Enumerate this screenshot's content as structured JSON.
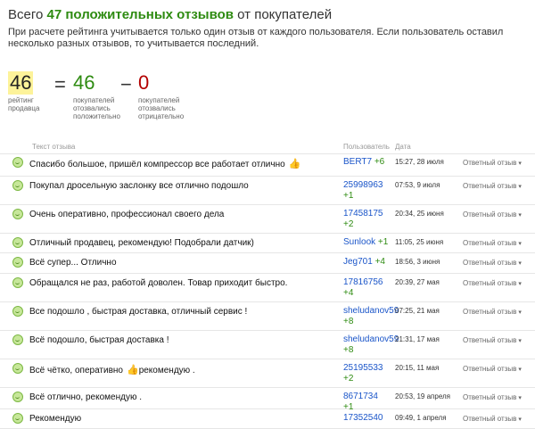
{
  "header": {
    "prefix": "Всего",
    "highlight": "47 положительных отзывов",
    "suffix": "от покупателей"
  },
  "notice": "При расчете рейтинга учитывается только один отзыв от каждого пользователя. Если пользователь оставил несколько разных отзывов, то учитывается последний.",
  "stats": {
    "rating": {
      "value": "46",
      "caption": "рейтинг продавца"
    },
    "equals": "=",
    "positive": {
      "value": "46",
      "caption": "покупателей отозвались положительно"
    },
    "minus": "−",
    "negative": {
      "value": "0",
      "caption": "покупателей отозвались отрицательно"
    }
  },
  "table": {
    "col_text": "Текст отзыва",
    "col_user": "Пользователь",
    "col_date": "Дата",
    "reply_label": "Ответный отзыв",
    "rows": [
      {
        "text": "Спасибо большое, пришёл компрессор все работает отлично",
        "thumb": "👍",
        "user": "BERT7",
        "score": "+6",
        "date": "15:27, 28 июля"
      },
      {
        "text": "Покупал дросельную заслонку все отлично подошло",
        "thumb": "",
        "user": "25998963",
        "score": "+1",
        "date": "07:53, 9 июля"
      },
      {
        "text": "Очень оперативно, профессионал своего дела",
        "thumb": "",
        "user": "17458175",
        "score": "+2",
        "date": "20:34, 25 июня"
      },
      {
        "text": "Отличный продавец, рекомендую! Подобрали датчик)",
        "thumb": "",
        "user": "Sunlook",
        "score": "+1",
        "date": "11:05, 25 июня"
      },
      {
        "text": "Всё супер... Отлично",
        "thumb": "",
        "user": "Jeg701",
        "score": "+4",
        "date": "18:56, 3 июня"
      },
      {
        "text": "Обращался не раз, работой доволен. Товар приходит быстро.",
        "thumb": "",
        "user": "17816756",
        "score": "+4",
        "date": "20:39, 27 мая"
      },
      {
        "text": "Все подошло , быстрая доставка, отличный сервис !",
        "thumb": "",
        "user": "sheludanov59",
        "score": "+8",
        "date": "07:25, 21 мая"
      },
      {
        "text": "Всё подошло, быстрая доставка !",
        "thumb": "",
        "user": "sheludanov59",
        "score": "+8",
        "date": "21:31, 17 мая"
      },
      {
        "text": "Всё чётко, оперативно",
        "thumb": "👍",
        "text_after": "рекомендую .",
        "user": "25195533",
        "score": "+2",
        "date": "20:15, 11 мая"
      },
      {
        "text": "Всё отлично, рекомендую .",
        "thumb": "",
        "user": "8671734",
        "score": "+1",
        "date": "20:53, 19 апреля"
      },
      {
        "text": "Рекомендую",
        "thumb": "",
        "user": "17352540",
        "score": "",
        "date": "09:49, 1 апреля"
      }
    ]
  }
}
